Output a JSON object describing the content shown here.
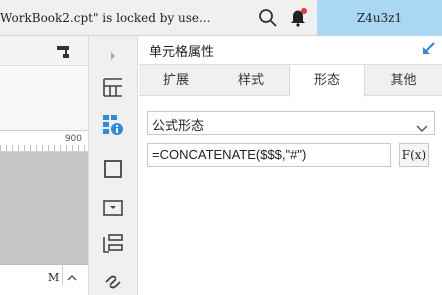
{
  "topbar": {
    "locked_message": "WorkBook2.cpt\" is locked by use...",
    "user": "Z4u3z1",
    "icons": [
      "search-icon",
      "notification-bell-icon"
    ],
    "bell_dot_color": "#e53935"
  },
  "editor": {
    "ruler_mark": "900",
    "column_label": "M",
    "icons": [
      "format-brush-icon",
      "column-sort-up-icon"
    ]
  },
  "icon_strip": {
    "icons": [
      "expand-arrow-icon",
      "cell-element-icon",
      "cell-attribute-icon",
      "border-icon",
      "widget-icon",
      "condition-attribute-icon",
      "hyperlink-icon"
    ],
    "active_color": "#2f8be0"
  },
  "panel": {
    "title": "单元格属性",
    "tabs": [
      {
        "label": "扩展"
      },
      {
        "label": "样式"
      },
      {
        "label": "形态",
        "active": true
      },
      {
        "label": "其他"
      }
    ],
    "form_select": {
      "value": "公式形态"
    },
    "formula": {
      "value": "=CONCATENATE($$$,\"#\")"
    },
    "fx_button_label": "F(x)",
    "accent_color": "#2f8be0"
  }
}
